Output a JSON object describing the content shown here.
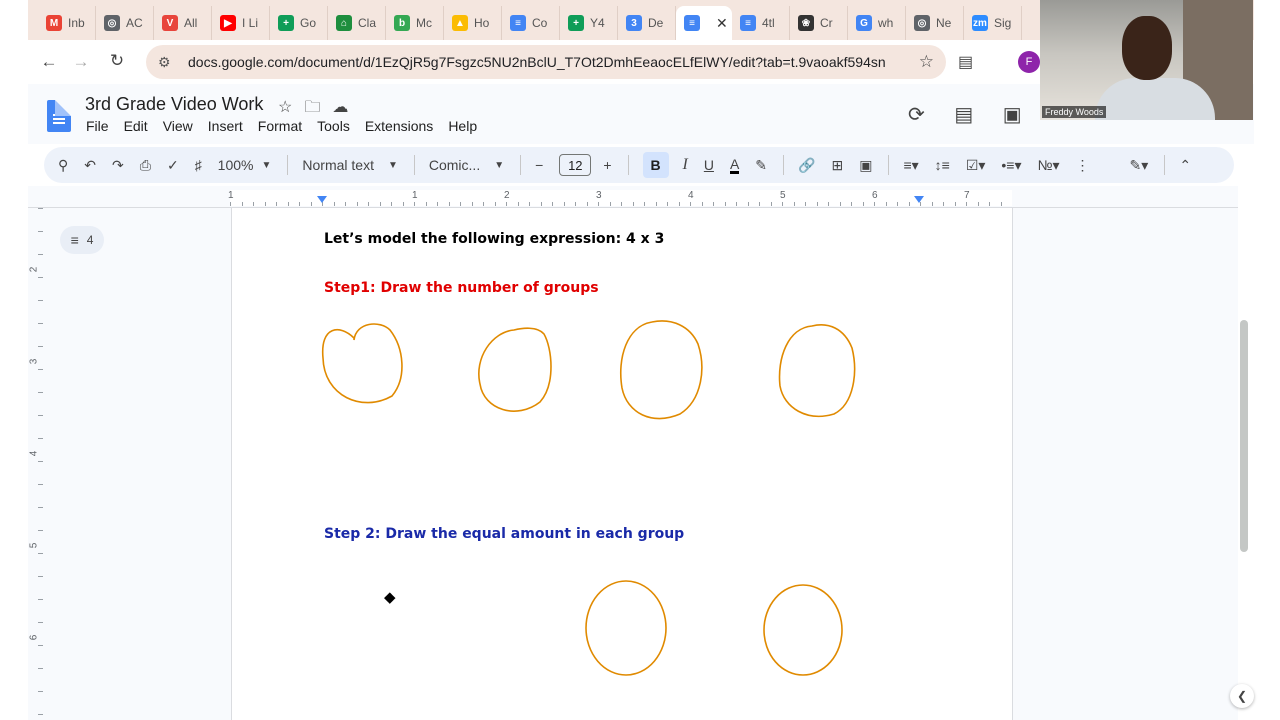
{
  "tabs": [
    {
      "label": "Inb",
      "icon": "gmail-icon",
      "color": "#ea4335",
      "glyph": "M",
      "active": false
    },
    {
      "label": "AC",
      "icon": "chrome-icon",
      "color": "#5f6368",
      "glyph": "◎",
      "active": false
    },
    {
      "label": "All",
      "icon": "app-icon",
      "color": "#e8453c",
      "glyph": "V",
      "active": false
    },
    {
      "label": "I Li",
      "icon": "youtube-icon",
      "color": "#ff0000",
      "glyph": "▶",
      "active": false
    },
    {
      "label": "Go",
      "icon": "sheets-icon",
      "color": "#0f9d58",
      "glyph": "+",
      "active": false
    },
    {
      "label": "Cla",
      "icon": "classroom-icon",
      "color": "#1e8e3e",
      "glyph": "⌂",
      "active": false
    },
    {
      "label": "Mc",
      "icon": "app-icon",
      "color": "#34a853",
      "glyph": "b",
      "active": false
    },
    {
      "label": "Ho",
      "icon": "drive-icon",
      "color": "#fbbc04",
      "glyph": "▲",
      "active": false
    },
    {
      "label": "Co",
      "icon": "docs-icon",
      "color": "#4285f4",
      "glyph": "≡",
      "active": false
    },
    {
      "label": "Y4",
      "icon": "sheets-icon",
      "color": "#0f9d58",
      "glyph": "+",
      "active": false
    },
    {
      "label": "De",
      "icon": "calendar-icon",
      "color": "#4285f4",
      "glyph": "3",
      "active": false
    },
    {
      "label": "",
      "icon": "docs-icon",
      "color": "#4285f4",
      "glyph": "≡",
      "active": true
    },
    {
      "label": "4tl",
      "icon": "docs-icon",
      "color": "#4285f4",
      "glyph": "≡",
      "active": false
    },
    {
      "label": "Cr",
      "icon": "openai-icon",
      "color": "#333333",
      "glyph": "❀",
      "active": false
    },
    {
      "label": "wh",
      "icon": "google-icon",
      "color": "#4285f4",
      "glyph": "G",
      "active": false
    },
    {
      "label": "Ne",
      "icon": "chrome-icon",
      "color": "#5f6368",
      "glyph": "◎",
      "active": false
    },
    {
      "label": "Sig",
      "icon": "zoom-icon",
      "color": "#2d8cff",
      "glyph": "zm",
      "active": false
    }
  ],
  "browser": {
    "url": "docs.google.com/document/d/1EzQjR5g7Fsgzc5NU2nBclU_T7Ot2DmhEeaocELfElWY/edit?tab=t.9vaoakf594sn",
    "profile_initial": "F"
  },
  "doc": {
    "title": "3rd Grade Video Work",
    "menus": [
      "File",
      "Edit",
      "View",
      "Insert",
      "Format",
      "Tools",
      "Extensions",
      "Help"
    ]
  },
  "toolbar": {
    "zoom": "100%",
    "style": "Normal text",
    "font": "Comic...",
    "font_size": "12",
    "bold": "B",
    "italic": "I",
    "underline": "U",
    "text_color": "A",
    "minus": "−",
    "plus": "+"
  },
  "ruler": {
    "numbers": [
      "1",
      "1",
      "2",
      "3",
      "4",
      "5",
      "6",
      "7"
    ]
  },
  "vruler": {
    "numbers": [
      "2",
      "3",
      "4",
      "5",
      "6"
    ]
  },
  "outline": {
    "count": "4"
  },
  "content": {
    "line1": "Let’s model the following expression: 4 x 3",
    "step1": "Step1: Draw the number of groups",
    "step2": "Step 2: Draw the equal amount in each group"
  },
  "colors": {
    "step1": "#e00000",
    "step2": "#1a2aa8",
    "drawing": "#e08a00"
  },
  "webcam": {
    "name": "Freddy Woods"
  }
}
